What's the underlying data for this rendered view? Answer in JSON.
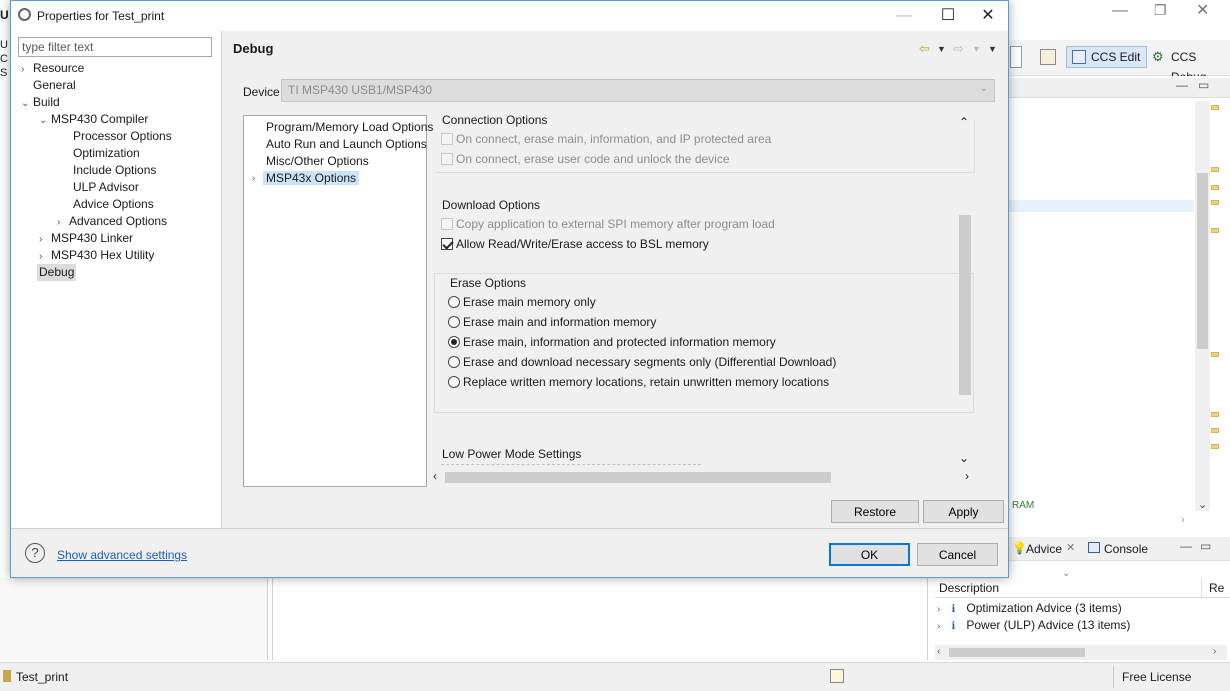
{
  "background": {
    "title_fragment": "U",
    "left_fragments": [
      "U",
      "C",
      "S"
    ],
    "perspectives": [
      {
        "label": "CCS Edit",
        "active": true
      },
      {
        "label": "CCS Debug",
        "active": false
      }
    ],
    "editor_fragment": "RAM",
    "advice_tab_label": "Advice",
    "console_tab_label": "Console",
    "advice_table_header": "Description",
    "advice_table_header2": "Re",
    "advice_rows": [
      {
        "label": "Optimization Advice (3 items)"
      },
      {
        "label": "Power (ULP) Advice (13 items)"
      }
    ],
    "status_project": "Test_print",
    "status_license": "Free License"
  },
  "dialog": {
    "title": "Properties for Test_print",
    "filter_placeholder": "type filter text",
    "tree": [
      {
        "label": "Resource",
        "arrow": "›"
      },
      {
        "label": "General",
        "arrow": ""
      },
      {
        "label": "Build",
        "arrow": "⌄"
      },
      {
        "label": "MSP430 Compiler",
        "arrow": "⌄"
      },
      {
        "label": "Processor Options",
        "arrow": ""
      },
      {
        "label": "Optimization",
        "arrow": ""
      },
      {
        "label": "Include Options",
        "arrow": ""
      },
      {
        "label": "ULP Advisor",
        "arrow": ""
      },
      {
        "label": "Advice Options",
        "arrow": ""
      },
      {
        "label": "Advanced Options",
        "arrow": "›"
      },
      {
        "label": "MSP430 Linker",
        "arrow": "›"
      },
      {
        "label": "MSP430 Hex Utility",
        "arrow": "›"
      },
      {
        "label": "Debug",
        "arrow": ""
      }
    ],
    "page_title": "Debug",
    "device_label": "Device",
    "device_value": "TI MSP430 USB1/MSP430",
    "option_categories": [
      {
        "label": "Program/Memory Load Options"
      },
      {
        "label": "Auto Run and Launch Options"
      },
      {
        "label": "Misc/Other Options"
      },
      {
        "label": "MSP43x Options"
      }
    ],
    "connection": {
      "title": "Connection Options",
      "items": [
        {
          "label": "On connect, erase main, information, and IP protected area",
          "checked": false,
          "enabled": false
        },
        {
          "label": "On connect, erase user code and unlock the device",
          "checked": false,
          "enabled": false
        }
      ]
    },
    "download": {
      "title": "Download Options",
      "items": [
        {
          "label": "Copy application to external SPI memory after program load",
          "checked": false,
          "enabled": false
        },
        {
          "label": "Allow Read/Write/Erase access to BSL memory",
          "checked": true,
          "enabled": true
        }
      ]
    },
    "erase": {
      "title": "Erase Options",
      "options": [
        {
          "label": "Erase main memory only",
          "selected": false
        },
        {
          "label": "Erase main and information memory",
          "selected": false
        },
        {
          "label": "Erase main, information and protected information memory",
          "selected": true
        },
        {
          "label": "Erase and download necessary segments only (Differential Download)",
          "selected": false
        },
        {
          "label": "Replace written memory locations, retain unwritten memory locations",
          "selected": false
        }
      ]
    },
    "low_power_title": "Low Power Mode Settings",
    "restore_defaults_label": "Restore Defaults",
    "apply_label": "Apply",
    "advanced_link": "Show advanced settings",
    "ok_label": "OK",
    "cancel_label": "Cancel"
  }
}
